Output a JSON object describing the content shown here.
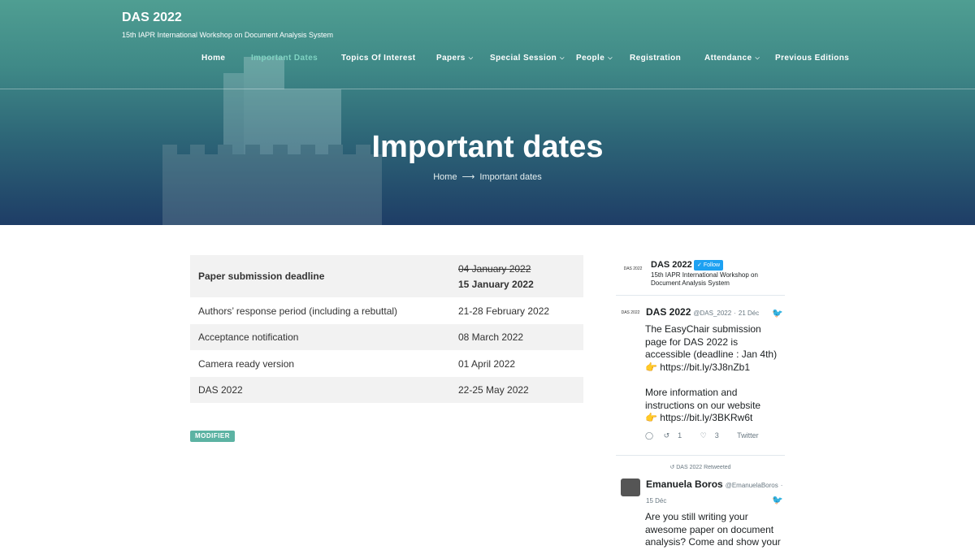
{
  "site": {
    "title": "DAS 2022",
    "subtitle": "15th IAPR International Workshop on Document Analysis System"
  },
  "nav": {
    "items": [
      {
        "label": "Home",
        "dropdown": false,
        "active": false
      },
      {
        "label": "Important Dates",
        "dropdown": false,
        "active": true
      },
      {
        "label": "Topics Of Interest",
        "dropdown": false,
        "active": false
      },
      {
        "label": "Papers",
        "dropdown": true,
        "active": false
      },
      {
        "label": "Special Session",
        "dropdown": true,
        "active": false
      },
      {
        "label": "People",
        "dropdown": true,
        "active": false
      },
      {
        "label": "Registration",
        "dropdown": false,
        "active": false
      },
      {
        "label": "Attendance",
        "dropdown": true,
        "active": false
      },
      {
        "label": "Previous Editions",
        "dropdown": false,
        "active": false
      }
    ]
  },
  "hero": {
    "title": "Important dates",
    "breadcrumb": {
      "home": "Home",
      "arrow": "⟶",
      "current": "Important dates"
    }
  },
  "dates_table": {
    "rows": [
      {
        "event": "Paper submission deadline",
        "old_date": "04 January 2022",
        "date": "15 January 2022",
        "emphasis": true
      },
      {
        "event": "Authors’ response period (including a rebuttal)",
        "date": "21-28 February 2022"
      },
      {
        "event": "Acceptance notification",
        "date": "08 March 2022"
      },
      {
        "event": "Camera ready version",
        "date": "01 April 2022"
      },
      {
        "event": "DAS 2022",
        "date": "22-25 May 2022"
      }
    ]
  },
  "edit_tag": "MODIFIER",
  "twitter": {
    "header": {
      "name": "DAS 2022",
      "follow": "Follow",
      "description": "15th IAPR International Workshop on Document Analysis System",
      "logo_text": "DAS 2022"
    },
    "tweet1": {
      "author": "DAS 2022",
      "handle": "@DAS_2022",
      "sep": "·",
      "date": "21 Déc",
      "lines": [
        "The EasyChair submission page for DAS 2022 is accessible (deadline : Jan 4th)",
        "👉 https://bit.ly/3J8nZb1",
        "",
        "More information and instructions on our website",
        "👉 https://bit.ly/3BKRw6t"
      ],
      "retweets": "1",
      "likes": "3",
      "source": "Twitter"
    },
    "retweet_label": "DAS 2022 Retweeted",
    "tweet2": {
      "author": "Emanuela Boros",
      "handle": "@EmanuelaBoros",
      "sep": "·",
      "date": "15 Déc",
      "text": "Are you still writing your awesome paper on document analysis? Come and show your"
    },
    "icon_color": "#1da1f2"
  },
  "colors": {
    "hero_top": "#4f9e92",
    "hero_bottom": "#1e3d66",
    "accent": "#5cb3a3",
    "active_nav": "#7fd3c2"
  }
}
